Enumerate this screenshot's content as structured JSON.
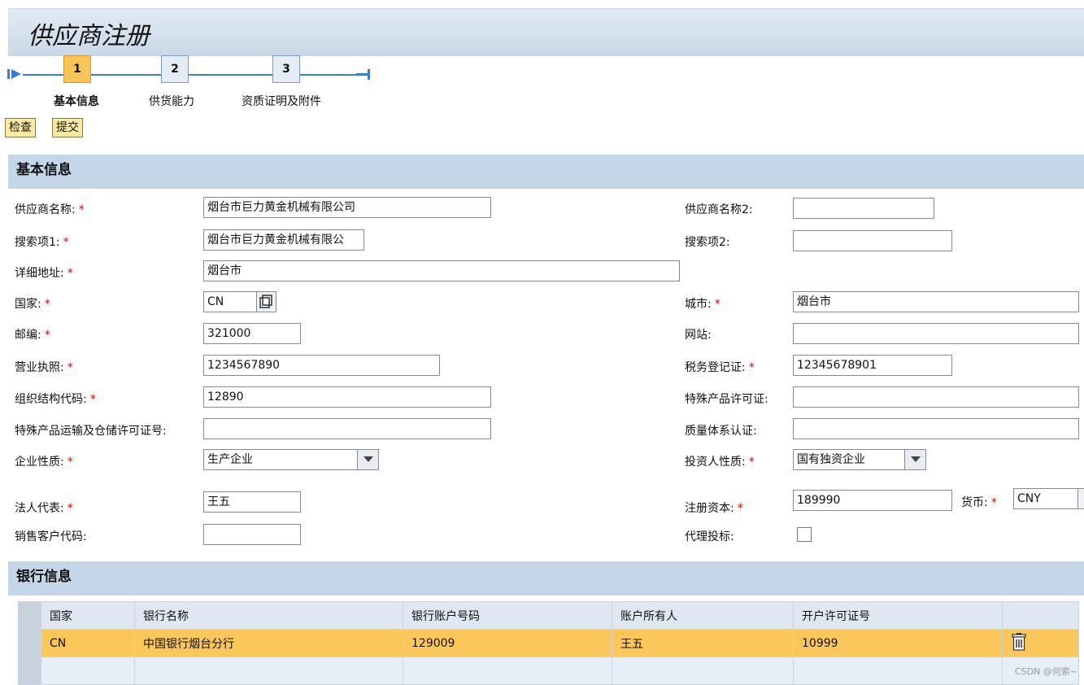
{
  "page": {
    "title": "供应商注册"
  },
  "roadmap": {
    "steps": [
      {
        "number": "1",
        "label": "基本信息"
      },
      {
        "number": "2",
        "label": "供货能力"
      },
      {
        "number": "3",
        "label": "资质证明及附件"
      }
    ],
    "active_step": 1
  },
  "toolbar": {
    "check_label": "检查",
    "submit_label": "提交"
  },
  "basic_info": {
    "header": "基本信息",
    "required_mark": "*",
    "supplier_name": {
      "label": "供应商名称:",
      "value": "烟台市巨力黄金机械有限公司"
    },
    "supplier_name2": {
      "label": "供应商名称2:",
      "value": ""
    },
    "search_term1": {
      "label": "搜索项1:",
      "value": "烟台市巨力黄金机械有限公"
    },
    "search_term2": {
      "label": "搜索项2:",
      "value": ""
    },
    "address": {
      "label": "详细地址:",
      "value": "烟台市"
    },
    "country": {
      "label": "国家:",
      "value": "CN"
    },
    "city": {
      "label": "城市:",
      "value": "烟台市"
    },
    "postal_code": {
      "label": "邮编:",
      "value": "321000"
    },
    "website": {
      "label": "网站:",
      "value": ""
    },
    "business_license": {
      "label": "营业执照:",
      "value": "1234567890"
    },
    "tax_registration": {
      "label": "税务登记证:",
      "value": "12345678901"
    },
    "org_code": {
      "label": "组织结构代码:",
      "value": "12890"
    },
    "special_product_license": {
      "label": "特殊产品许可证:",
      "value": ""
    },
    "special_transport_license": {
      "label": "特殊产品运输及仓储许可证号:",
      "value": ""
    },
    "quality_cert": {
      "label": "质量体系认证:",
      "value": ""
    },
    "enterprise_type": {
      "label": "企业性质:",
      "value": "生产企业"
    },
    "investor_type": {
      "label": "投资人性质:",
      "value": "国有独资企业"
    },
    "legal_rep": {
      "label": "法人代表:",
      "value": "王五"
    },
    "registered_capital": {
      "label": "注册资本:",
      "value": "189990"
    },
    "currency": {
      "label": "货币:",
      "value": "CNY"
    },
    "sales_customer_code": {
      "label": "销售客户代码:",
      "value": ""
    },
    "proxy_bidding": {
      "label": "代理投标:",
      "checked": false
    }
  },
  "bank_info": {
    "header": "银行信息",
    "columns": [
      "国家",
      "银行名称",
      "银行账户号码",
      "账户所有人",
      "开户许可证号"
    ],
    "rows": [
      [
        "CN",
        "中国银行烟台分行",
        "129009",
        "王五",
        "10999"
      ]
    ]
  },
  "watermark": "CSDN @何索~",
  "colors": {
    "accent": "#3a7bd5",
    "active_step": "#f7c455",
    "selected_row": "#fbc65a",
    "section_header": "#c5d6e8",
    "required": "#dd0000"
  }
}
